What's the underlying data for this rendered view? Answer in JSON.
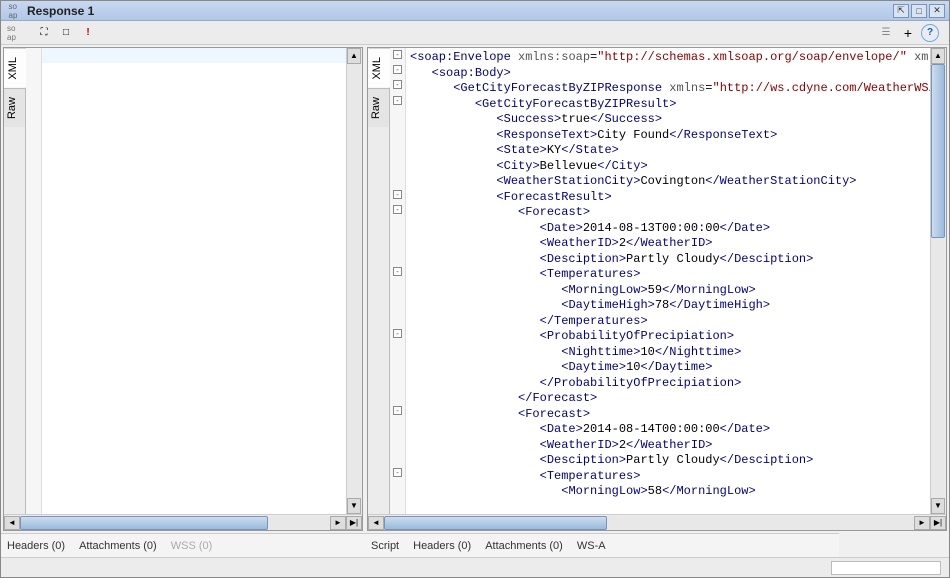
{
  "titlebar": {
    "title": "Response 1"
  },
  "left": {
    "tabs": {
      "xml": "XML",
      "raw": "Raw"
    },
    "bottom": {
      "headers": "Headers (0)",
      "attachments": "Attachments (0)",
      "wss": "WSS (0)"
    }
  },
  "right": {
    "tabs": {
      "xml": "XML",
      "raw": "Raw"
    },
    "bottom": {
      "script": "Script",
      "headers": "Headers (0)",
      "attachments": "Attachments (0)",
      "wsa": "WS-A"
    }
  },
  "xml": {
    "envelope": {
      "tag": "soap:Envelope",
      "attrName": "xmlns:soap",
      "attrVal": "http://schemas.xmlsoap.org/soap/envelope/",
      "attrName2": "xmlns:x"
    },
    "body": "soap:Body",
    "resp": {
      "tag": "GetCityForecastByZIPResponse",
      "attrName": "xmlns",
      "attrVal": "http://ws.cdyne.com/WeatherWS/"
    },
    "result": "GetCityForecastByZIPResult",
    "success": {
      "tag": "Success",
      "val": "true"
    },
    "responseText": {
      "tag": "ResponseText",
      "val": "City Found"
    },
    "state": {
      "tag": "State",
      "val": "KY"
    },
    "city": {
      "tag": "City",
      "val": "Bellevue"
    },
    "wsc": {
      "tag": "WeatherStationCity",
      "val": "Covington"
    },
    "forecastResult": "ForecastResult",
    "forecast": "Forecast",
    "date": "Date",
    "weatherID": {
      "tag": "WeatherID",
      "val": "2"
    },
    "desc": {
      "tag": "Desciption",
      "val": "Partly Cloudy"
    },
    "temps": "Temperatures",
    "morningLow": "MorningLow",
    "daytimeHigh": {
      "tag": "DaytimeHigh",
      "val": "78"
    },
    "pop": "ProbabilityOfPrecipiation",
    "night": {
      "tag": "Nighttime",
      "val": "10"
    },
    "day": {
      "tag": "Daytime",
      "val": "10"
    },
    "f1": {
      "date": "2014-08-13T00:00:00",
      "mlow": "59"
    },
    "f2": {
      "date": "2014-08-14T00:00:00",
      "mlow": "58"
    }
  }
}
